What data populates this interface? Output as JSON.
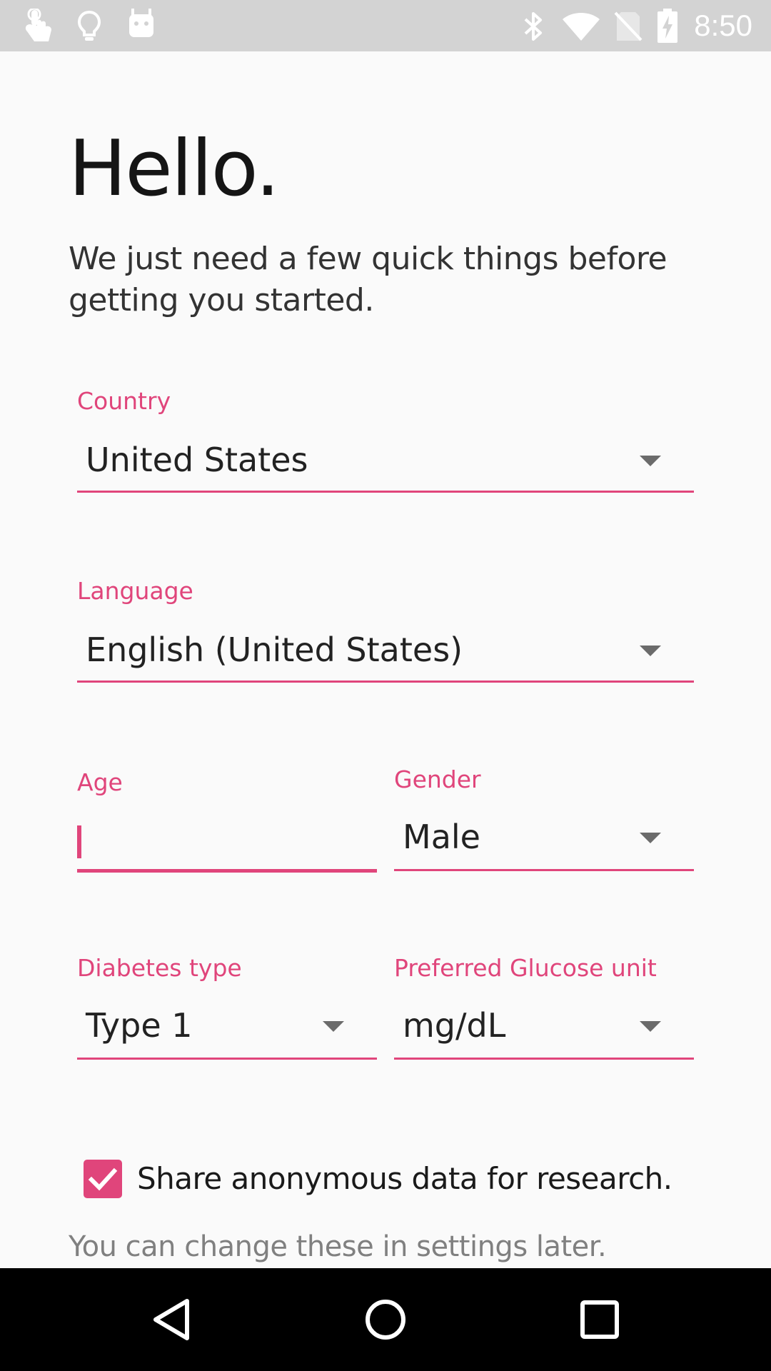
{
  "status_bar": {
    "time": "8:50",
    "left_icons": [
      "touch-app-icon",
      "lightbulb-icon",
      "android-icon"
    ],
    "right_icons": [
      "bluetooth-icon",
      "wifi-icon",
      "no-sim-icon",
      "battery-charging-icon"
    ]
  },
  "header": {
    "title": "Hello.",
    "subtitle": "We just need a few quick things before getting you started."
  },
  "form": {
    "country": {
      "label": "Country",
      "value": "United States"
    },
    "language": {
      "label": "Language",
      "value": "English (United States)"
    },
    "age": {
      "label": "Age",
      "value": ""
    },
    "gender": {
      "label": "Gender",
      "value": "Male"
    },
    "diabetes_type": {
      "label": "Diabetes type",
      "value": "Type 1"
    },
    "glucose_unit": {
      "label": "Preferred Glucose unit",
      "value": "mg/dL"
    },
    "share_data": {
      "label": "Share anonymous data for research.",
      "checked": true
    },
    "footer_note": "You can change these in settings later."
  },
  "nav_bar": {
    "buttons": [
      "back-icon",
      "home-icon",
      "recents-icon"
    ]
  },
  "colors": {
    "accent": "#e0457b",
    "status_bar": "#d3d3d3",
    "nav_bar": "#000000",
    "background": "#fafafa"
  }
}
